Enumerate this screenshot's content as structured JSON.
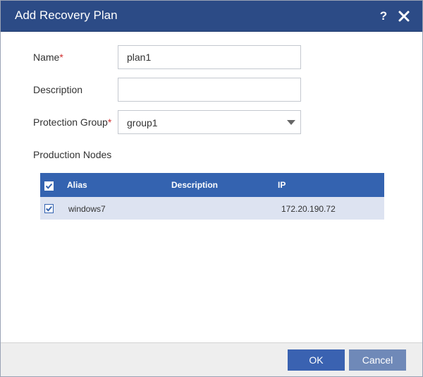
{
  "dialog": {
    "title": "Add Recovery Plan",
    "help_label": "?",
    "close_icon": "close-icon"
  },
  "form": {
    "name": {
      "label": "Name",
      "required_mark": "*",
      "value": "plan1"
    },
    "description": {
      "label": "Description",
      "value": ""
    },
    "protection_group": {
      "label": "Protection Group",
      "required_mark": "*",
      "selected": "group1"
    },
    "production_nodes_label": "Production Nodes"
  },
  "nodes_table": {
    "columns": [
      "Alias",
      "Description",
      "IP"
    ],
    "header_checked": true,
    "rows": [
      {
        "checked": true,
        "alias": "windows7",
        "description": "",
        "ip": "172.20.190.72"
      }
    ]
  },
  "footer": {
    "ok_label": "OK",
    "cancel_label": "Cancel"
  },
  "colors": {
    "title_bar": "#2c4b86",
    "table_header": "#3463b0",
    "selected_row": "#dde3f1",
    "ok_button": "#3a62b1",
    "cancel_button": "#6f89b8",
    "required": "#d22f2f"
  }
}
